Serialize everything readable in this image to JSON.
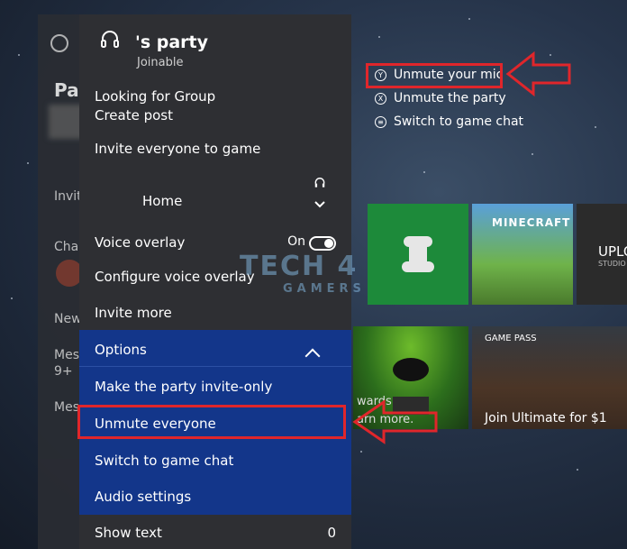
{
  "party": {
    "title": "'s party",
    "status": "Joinable"
  },
  "menu": {
    "looking_for_group": "Looking for Group",
    "create_post": "Create post",
    "invite_everyone": "Invite everyone to game",
    "home": "Home",
    "voice_overlay": "Voice overlay",
    "voice_overlay_state": "On",
    "configure_voice_overlay": "Configure voice overlay",
    "invite_more": "Invite more",
    "options": "Options",
    "invite_only": "Make the party invite-only",
    "unmute_everyone": "Unmute everyone",
    "switch_game_chat": "Switch to game chat",
    "audio_settings": "Audio settings",
    "show_text": "Show text",
    "show_text_count": "0"
  },
  "hints": [
    {
      "button": "Y",
      "label": "Unmute your mic"
    },
    {
      "button": "X",
      "label": "Unmute the party"
    },
    {
      "button": "≡",
      "label": "Switch to game chat"
    }
  ],
  "left_panel": {
    "title": "Par",
    "invite": "Invit",
    "chat": "Cha",
    "new": "New",
    "messages": "Mes",
    "count": "9+",
    "messages2": "Mes"
  },
  "tiles": {
    "rewards_line1": "wards",
    "rewards_line2": "arn more.",
    "gamepass_badge": "GAME PASS",
    "gamepass_label": "Join Ultimate for $1",
    "minecraft": "MINECRAFT",
    "uplo": "UPLO",
    "uplo_sub": "STUDIO"
  },
  "watermark": {
    "main": "TECH 4",
    "sub": "GAMERS"
  },
  "colors": {
    "highlight": "#e0262b",
    "options_bg": "#13368a",
    "menu_bg": "#2e2f33"
  }
}
